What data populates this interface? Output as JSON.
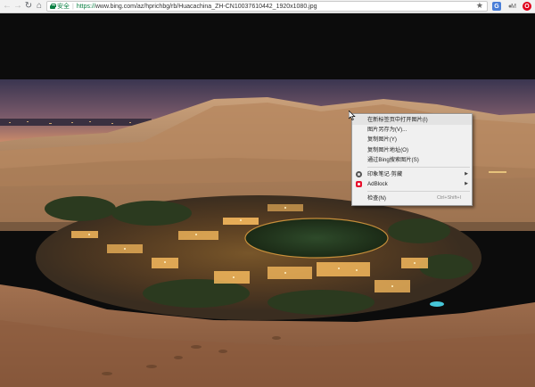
{
  "browser": {
    "security_label": "安全",
    "url_scheme": "https://",
    "url_rest": "www.bing.com/az/hprichbg/rb/Huacachina_ZH-CN10037610442_1920x1080.jpg",
    "star_icon": "★"
  },
  "context_menu": {
    "items": [
      {
        "label": "在新标签页中打开图片(I)"
      },
      {
        "label": "图片另存为(V)..."
      },
      {
        "label": "复制图片(Y)"
      },
      {
        "label": "复制图片地址(O)"
      },
      {
        "label": "通过Bing搜索图片(S)"
      },
      {
        "label": "印象笔记·剪藏"
      },
      {
        "label": "AdBlock"
      },
      {
        "label": "检查(N)",
        "shortcut": "Ctrl+Shift+I"
      }
    ]
  }
}
